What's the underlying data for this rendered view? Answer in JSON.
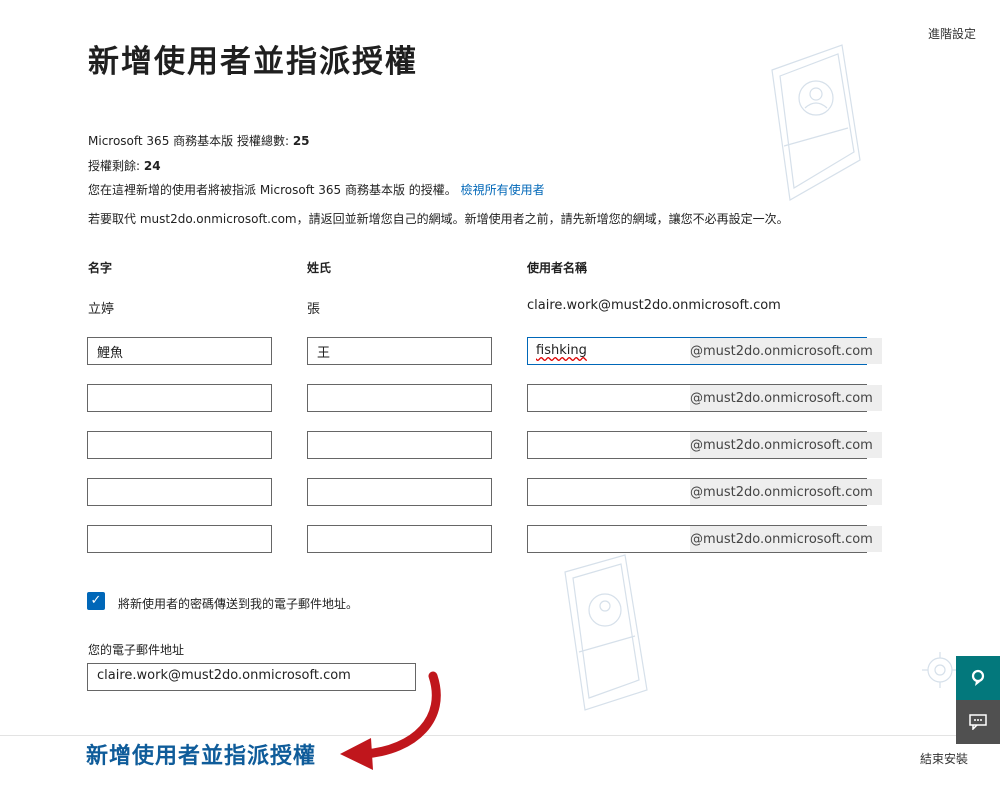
{
  "page": {
    "title": "新增使用者並指派授權",
    "advanced_settings": "進階設定"
  },
  "license_info": {
    "product_line_prefix": "Microsoft 365 商務基本版 授權總數: ",
    "total": "25",
    "remaining_label": "授權剩餘: ",
    "remaining": "24",
    "assign_text": "您在這裡新增的使用者將被指派 Microsoft 365 商務基本版 的授權。",
    "view_all_link": "檢視所有使用者",
    "domain_note": "若要取代 must2do.onmicrosoft.com，請返回並新增您自己的網域。新增使用者之前，請先新增您的網域，讓您不必再設定一次。"
  },
  "columns": {
    "first_name": "名字",
    "last_name": "姓氏",
    "username": "使用者名稱"
  },
  "existing_user": {
    "first_name": "立婷",
    "last_name": "張",
    "email": "claire.work@must2do.onmicrosoft.com"
  },
  "domain_suffix": "@must2do.onmicrosoft.com",
  "rows": [
    {
      "first": "鯉魚",
      "last": "王",
      "user": "fishking"
    },
    {
      "first": "",
      "last": "",
      "user": ""
    },
    {
      "first": "",
      "last": "",
      "user": ""
    },
    {
      "first": "",
      "last": "",
      "user": ""
    },
    {
      "first": "",
      "last": "",
      "user": ""
    }
  ],
  "send_password": {
    "checked": true,
    "label": "將新使用者的密碼傳送到我的電子郵件地址。"
  },
  "email": {
    "label": "您的電子郵件地址",
    "value": "claire.work@must2do.onmicrosoft.com"
  },
  "footer": {
    "cta": "新增使用者並指派授權",
    "finish": "結束安裝"
  },
  "side_buttons": [
    {
      "icon": "feedback-icon",
      "color": "#03787c"
    },
    {
      "icon": "chat-icon",
      "color": "#505050"
    }
  ],
  "colors": {
    "accent": "#0067b8",
    "annotation_arrow": "#c0161c"
  }
}
